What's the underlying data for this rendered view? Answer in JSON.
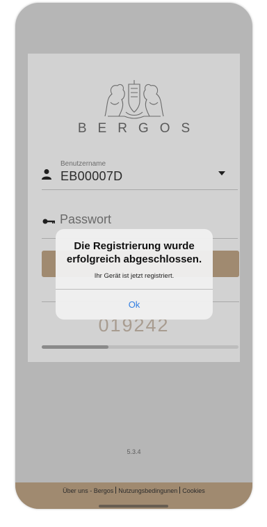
{
  "brand": {
    "name": "BERGOS"
  },
  "login": {
    "username_label": "Benutzername",
    "username_value": "EB00007D",
    "password_placeholder": "Passwort",
    "code": "019242",
    "progress_fraction": 0.34
  },
  "alert": {
    "title": "Die Registrierung wurde erfolgreich abgeschlossen.",
    "message": "Ihr Gerät ist jetzt registriert.",
    "ok_label": "Ok"
  },
  "version": "5.3.4",
  "footer": {
    "about_label": "Über uns - Bergos",
    "terms_label": "Nutzungsbedingunen",
    "cookies_label": "Cookies"
  },
  "colors": {
    "accent": "#a08a70",
    "link": "#2f7de1"
  }
}
